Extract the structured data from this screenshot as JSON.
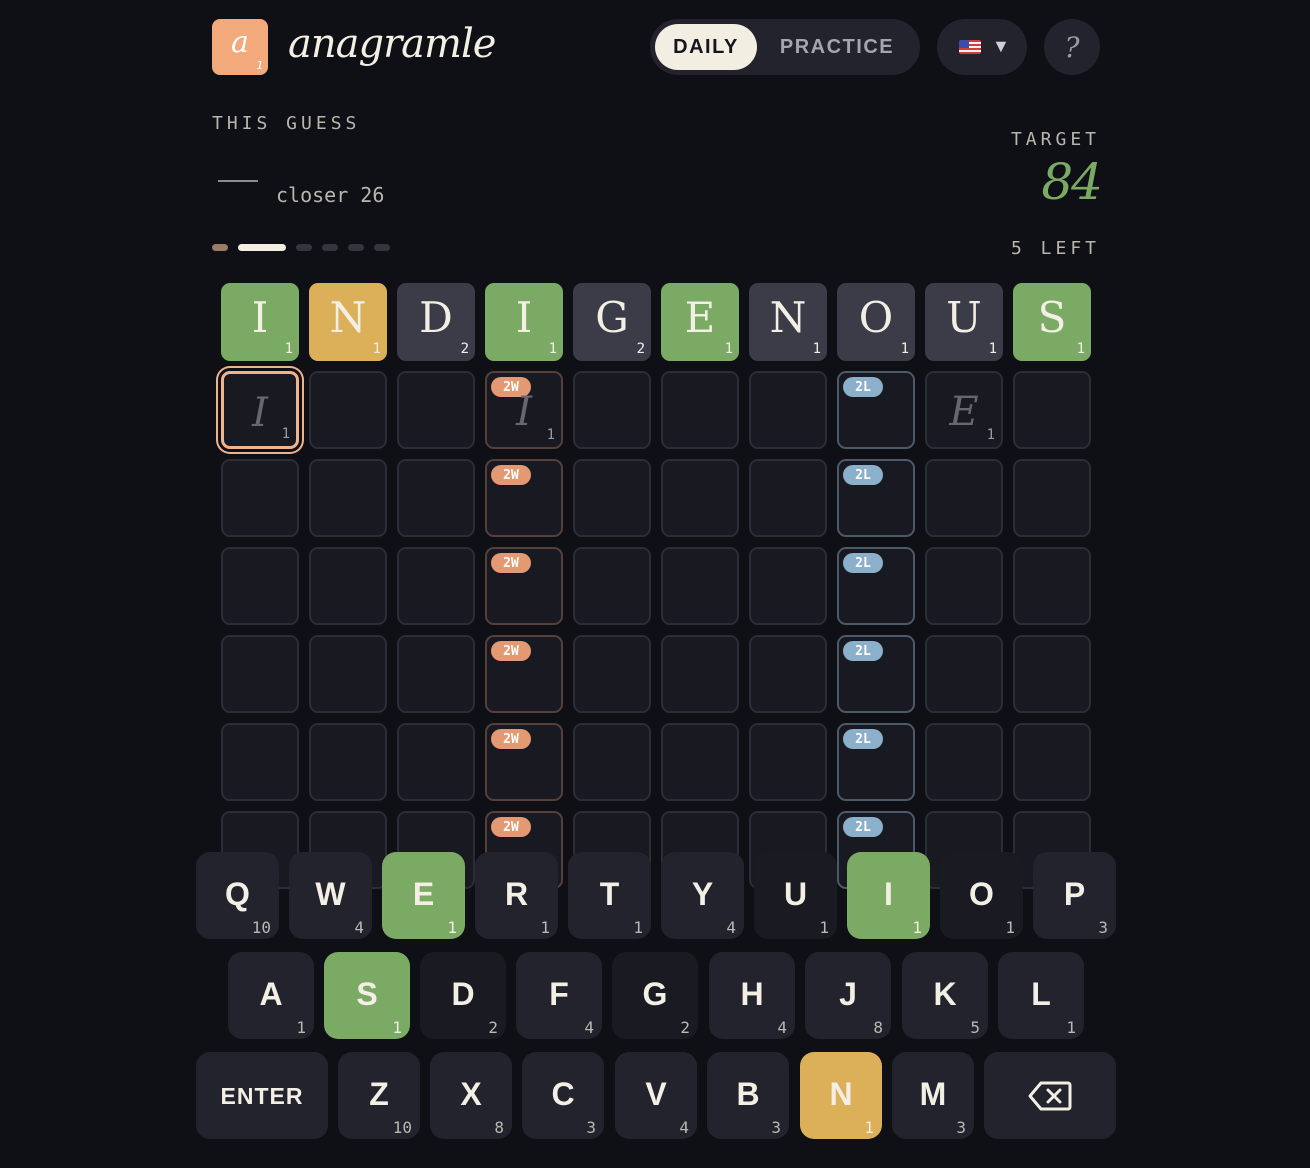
{
  "header": {
    "logo_letter": "a",
    "logo_sub": "1",
    "app_title": "anagramle",
    "mode_daily": "DAILY",
    "mode_practice": "PRACTICE",
    "help_label": "?",
    "flag_icon": "us-flag-icon",
    "caret_icon": "▼"
  },
  "info": {
    "this_guess_label": "THIS GUESS",
    "closer_text": "closer 26",
    "target_label": "TARGET",
    "target_value": "84",
    "left_text": "5 LEFT",
    "progress_active_index": 1
  },
  "board": {
    "answer_row": [
      {
        "letter": "I",
        "num": "1",
        "state": "green"
      },
      {
        "letter": "N",
        "num": "1",
        "state": "yellow"
      },
      {
        "letter": "D",
        "num": "2",
        "state": "gray"
      },
      {
        "letter": "I",
        "num": "1",
        "state": "green"
      },
      {
        "letter": "G",
        "num": "2",
        "state": "gray"
      },
      {
        "letter": "E",
        "num": "1",
        "state": "green"
      },
      {
        "letter": "N",
        "num": "1",
        "state": "gray"
      },
      {
        "letter": "O",
        "num": "1",
        "state": "gray"
      },
      {
        "letter": "U",
        "num": "1",
        "state": "gray"
      },
      {
        "letter": "S",
        "num": "1",
        "state": "green"
      }
    ],
    "hint_row": [
      {
        "col": 0,
        "letter": "I",
        "num": "1"
      },
      {
        "col": 3,
        "letter": "I",
        "num": "1"
      },
      {
        "col": 8,
        "letter": "E",
        "num": "1"
      }
    ],
    "double_word_badge": "2W",
    "double_letter_badge": "2L",
    "empty_rows": 5
  },
  "keyboard": {
    "rows": [
      [
        {
          "letter": "Q",
          "num": "10",
          "state": "normal"
        },
        {
          "letter": "W",
          "num": "4",
          "state": "normal"
        },
        {
          "letter": "E",
          "num": "1",
          "state": "green"
        },
        {
          "letter": "R",
          "num": "1",
          "state": "normal"
        },
        {
          "letter": "T",
          "num": "1",
          "state": "normal"
        },
        {
          "letter": "Y",
          "num": "4",
          "state": "normal"
        },
        {
          "letter": "U",
          "num": "1",
          "state": "dark"
        },
        {
          "letter": "I",
          "num": "1",
          "state": "green"
        },
        {
          "letter": "O",
          "num": "1",
          "state": "dark"
        },
        {
          "letter": "P",
          "num": "3",
          "state": "normal"
        }
      ],
      [
        {
          "letter": "A",
          "num": "1",
          "state": "normal"
        },
        {
          "letter": "S",
          "num": "1",
          "state": "green"
        },
        {
          "letter": "D",
          "num": "2",
          "state": "dark"
        },
        {
          "letter": "F",
          "num": "4",
          "state": "normal"
        },
        {
          "letter": "G",
          "num": "2",
          "state": "dark"
        },
        {
          "letter": "H",
          "num": "4",
          "state": "normal"
        },
        {
          "letter": "J",
          "num": "8",
          "state": "normal"
        },
        {
          "letter": "K",
          "num": "5",
          "state": "normal"
        },
        {
          "letter": "L",
          "num": "1",
          "state": "normal"
        }
      ],
      [
        {
          "letter": "Z",
          "num": "10",
          "state": "normal"
        },
        {
          "letter": "X",
          "num": "8",
          "state": "normal"
        },
        {
          "letter": "C",
          "num": "3",
          "state": "normal"
        },
        {
          "letter": "V",
          "num": "4",
          "state": "normal"
        },
        {
          "letter": "B",
          "num": "3",
          "state": "normal"
        },
        {
          "letter": "N",
          "num": "1",
          "state": "yellow"
        },
        {
          "letter": "M",
          "num": "3",
          "state": "normal"
        }
      ]
    ],
    "enter_label": "ENTER",
    "backspace_icon": "backspace-icon"
  },
  "colors": {
    "background": "#0f1016",
    "green": "#7aaa63",
    "yellow": "#dcb059",
    "accent": "#f2a97c",
    "double_word": "#e39972",
    "double_letter": "#8ab0cb"
  }
}
